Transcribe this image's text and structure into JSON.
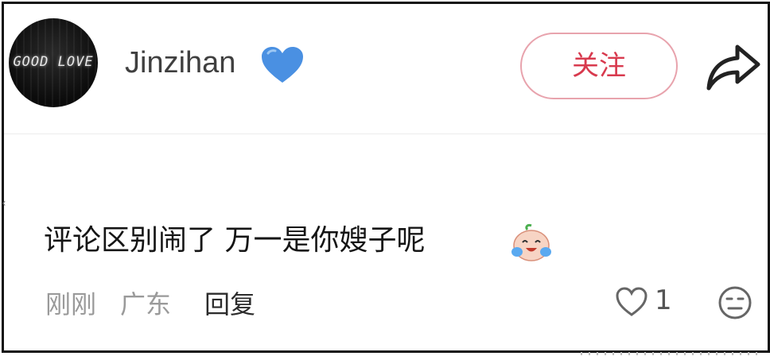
{
  "header": {
    "avatar_text": "GOOD LOVE",
    "username": "Jinzihan",
    "follow_label": "关注"
  },
  "comment": {
    "text": "评论区别闹了 万一是你嫂子呢"
  },
  "meta": {
    "time": "刚刚",
    "location": "广东",
    "reply_label": "回复",
    "like_count": "1"
  },
  "colors": {
    "accent": "#d83a4e",
    "button_border": "#e8a3ad",
    "heart": "#4a90e2",
    "meta_gray": "#9a9a9a"
  },
  "icons": {
    "heart": "blue-heart-icon",
    "share": "share-arrow-icon",
    "emoji": "crying-laughing-emoji-icon",
    "like": "heart-outline-icon",
    "dislike": "neutral-face-icon"
  }
}
